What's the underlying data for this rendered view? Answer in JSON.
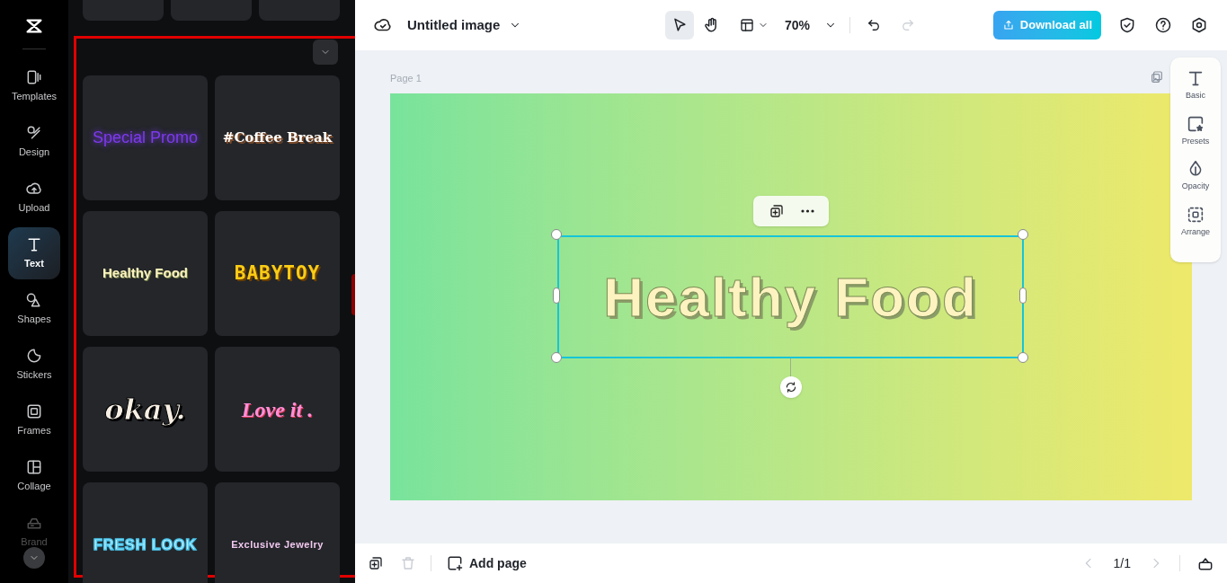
{
  "sidebar": [
    {
      "label": "Templates",
      "selected": false
    },
    {
      "label": "Design",
      "selected": false
    },
    {
      "label": "Upload",
      "selected": false
    },
    {
      "label": "Text",
      "selected": true
    },
    {
      "label": "Shapes",
      "selected": false
    },
    {
      "label": "Stickers",
      "selected": false
    },
    {
      "label": "Frames",
      "selected": false
    },
    {
      "label": "Collage",
      "selected": false
    },
    {
      "label": "Brand",
      "selected": false
    }
  ],
  "panel": {
    "cards": [
      {
        "text": "Special Promo",
        "kind": "neon"
      },
      {
        "text": "#Coffee Break",
        "kind": "stamp"
      },
      {
        "text": "Healthy Food",
        "kind": "cream"
      },
      {
        "text": "BABYTOY",
        "kind": "blocky"
      },
      {
        "text": "okay.",
        "kind": "sticker"
      },
      {
        "text": "Love it .",
        "kind": "script"
      },
      {
        "text": "FRESH LOOK",
        "kind": "outline"
      },
      {
        "text": "Exclusive Jewelry",
        "kind": "small"
      }
    ]
  },
  "toolbar": {
    "title": "Untitled image",
    "tools": [
      {
        "kind": "pointer",
        "selected": true
      },
      {
        "kind": "hand",
        "selected": false
      }
    ],
    "zoom": "70%",
    "redo_disabled": true,
    "download": "Download all"
  },
  "canvas": {
    "page_label": "Page 1",
    "text": "Healthy Food"
  },
  "side_tools": [
    "Basic",
    "Presets",
    "Opacity",
    "Arrange"
  ],
  "footer": {
    "delete_disabled": true,
    "add_page": "Add page",
    "prev_disabled": true,
    "page_count": "1/1",
    "next_disabled": true
  }
}
